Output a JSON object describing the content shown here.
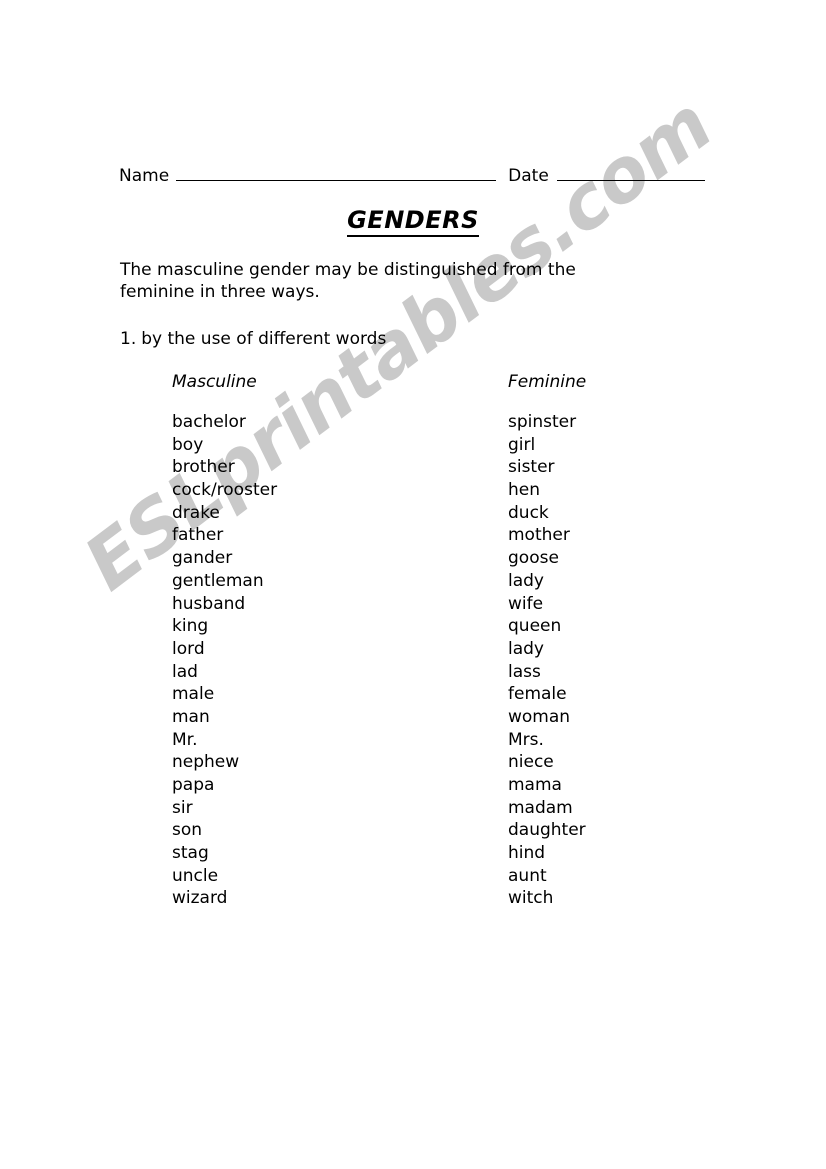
{
  "header": {
    "name_label": "Name",
    "date_label": "Date"
  },
  "title": "GENDERS",
  "intro": "The masculine gender may be distinguished from the feminine in three ways.",
  "rule": {
    "number": "1.",
    "text": "by the use of different words"
  },
  "table": {
    "columns": [
      "Masculine",
      "Feminine"
    ],
    "rows": [
      [
        "bachelor",
        "spinster"
      ],
      [
        "boy",
        "girl"
      ],
      [
        "brother",
        "sister"
      ],
      [
        "cock/rooster",
        "hen"
      ],
      [
        "drake",
        "duck"
      ],
      [
        "father",
        "mother"
      ],
      [
        "gander",
        "goose"
      ],
      [
        "gentleman",
        "lady"
      ],
      [
        "husband",
        "wife"
      ],
      [
        "king",
        "queen"
      ],
      [
        "lord",
        "lady"
      ],
      [
        "lad",
        "lass"
      ],
      [
        "male",
        "female"
      ],
      [
        "man",
        "woman"
      ],
      [
        "Mr.",
        "Mrs."
      ],
      [
        "nephew",
        "niece"
      ],
      [
        "papa",
        "mama"
      ],
      [
        "sir",
        "madam"
      ],
      [
        "son",
        "daughter"
      ],
      [
        "stag",
        "hind"
      ],
      [
        "uncle",
        "aunt"
      ],
      [
        "wizard",
        "witch"
      ]
    ]
  },
  "watermark": {
    "text": "ESLprintables.com",
    "color": "#c9c9c9"
  }
}
